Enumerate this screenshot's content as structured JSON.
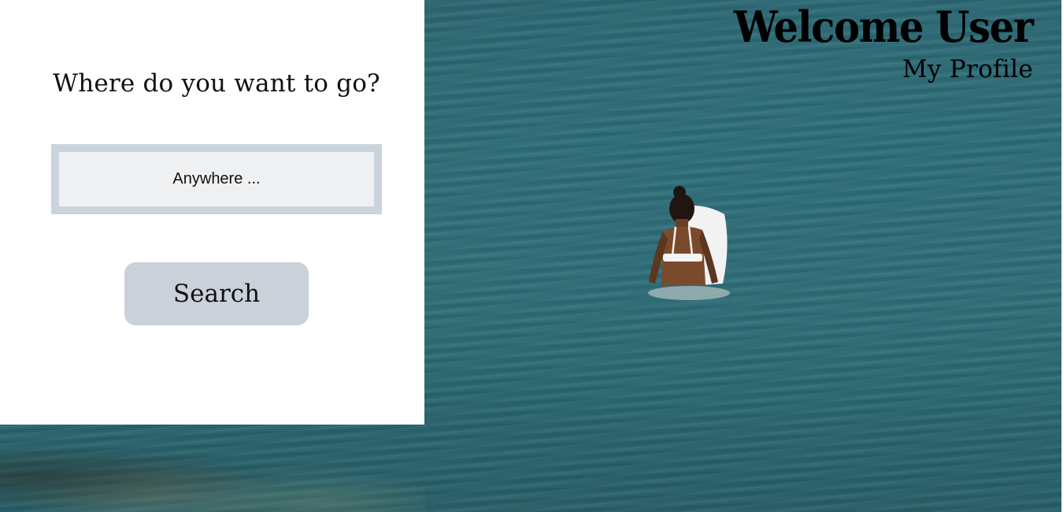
{
  "header": {
    "welcome_text": "Welcome User",
    "profile_link": "My Profile"
  },
  "search_panel": {
    "question": "Where do you want to go?",
    "destination_placeholder": "Anywhere ...",
    "destination_value": "",
    "search_label": "Search"
  },
  "colors": {
    "panel_bg": "#ffffff",
    "input_border": "#cbd4dc",
    "input_bg": "#eef0f2",
    "button_bg": "#cbd1d9",
    "ocean": "#2f6e78"
  }
}
